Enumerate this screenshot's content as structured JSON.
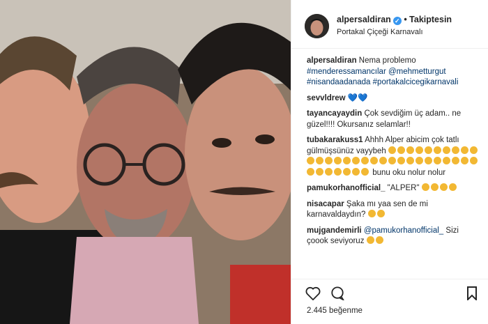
{
  "post": {
    "username": "alpersaldiran",
    "follow_label": "Takiptesin",
    "location": "Portakal Çiçeği Karnavalı",
    "likes": "2.445 beğenme"
  },
  "comments": [
    {
      "user": "alpersaldiran",
      "parts": [
        "Nema problemo ",
        "#menderessamancılar",
        " ",
        "@mehmetturgut",
        " ",
        "#nisandaadanada",
        " ",
        "#portakalcicegikarnavali"
      ]
    },
    {
      "user": "sevvldrew",
      "text": "💙💙"
    },
    {
      "user": "tayancayaydin",
      "text": "Çok sevdiğim üç adam.. ne güzel!!!! Okursanız selamlar!!"
    },
    {
      "user": "tubakarakuss1",
      "text": "Ahhh Alper abicim çok tatlı gülmüşsünüz vayybeh",
      "emoji_count": 36,
      "tail": "bunu oku nolur nolur"
    },
    {
      "user": "pamukorhanofficial_",
      "text": "\"ALPER\"",
      "emoji_count": 4
    },
    {
      "user": "nisacapar",
      "text": "Şaka mı yaa sen de mi karnavaldaydın?",
      "emoji_count": 2
    },
    {
      "user": "mujgandemirli",
      "mention": "@pamukorhanofficial_",
      "text": "Sizi çoook seviyoruz",
      "emoji_count": 2
    }
  ],
  "icons": {
    "like": "heart-outline-icon",
    "comment": "speech-bubble-icon",
    "save": "bookmark-icon"
  }
}
